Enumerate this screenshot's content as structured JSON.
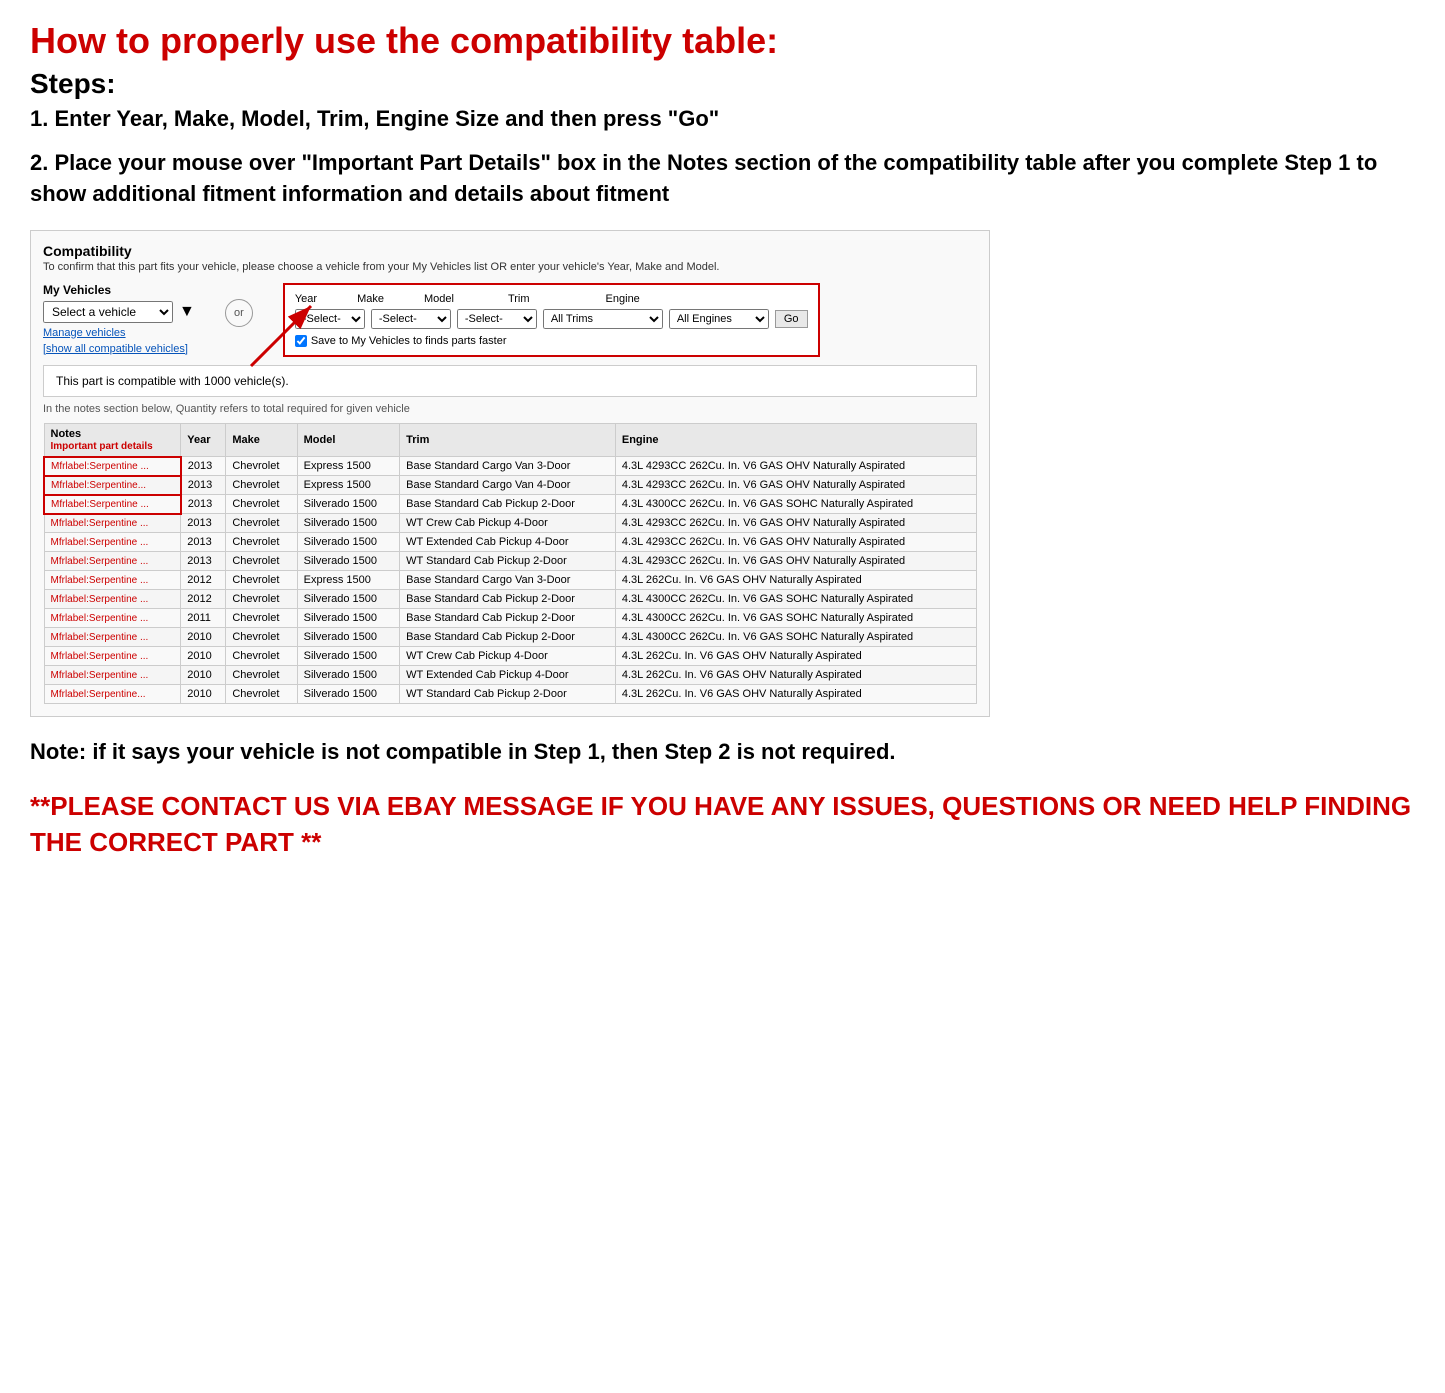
{
  "title": "How to properly use the compatibility table:",
  "steps_heading": "Steps:",
  "step1": "1. Enter Year, Make, Model, Trim, Engine Size and then press \"Go\"",
  "step2": "2. Place your mouse over \"Important Part Details\" box in the Notes section of the compatibility table after you complete Step 1 to show additional fitment information and details about fitment",
  "compatibility": {
    "title": "Compatibility",
    "subtitle": "To confirm that this part fits your vehicle, please choose a vehicle from your My Vehicles list OR enter your vehicle's Year, Make and Model.",
    "my_vehicles_label": "My Vehicles",
    "select_vehicle_placeholder": "Select a vehicle",
    "manage_vehicles": "Manage vehicles",
    "show_all": "[show all compatible vehicles]",
    "or_label": "or",
    "year_label": "Year",
    "make_label": "Make",
    "model_label": "Model",
    "trim_label": "Trim",
    "engine_label": "Engine",
    "year_default": "-Select-",
    "make_default": "-Select-",
    "model_default": "-Select-",
    "trim_default": "All Trims",
    "engine_default": "All Engines",
    "go_button": "Go",
    "save_check_label": "Save to My Vehicles to finds parts faster",
    "compatible_text": "This part is compatible with 1000 vehicle(s).",
    "quantity_note": "In the notes section below, Quantity refers to total required for given vehicle",
    "table_headers": [
      "Notes",
      "Year",
      "Make",
      "Model",
      "Trim",
      "Engine"
    ],
    "notes_sub_header": "Important part details",
    "table_rows": [
      [
        "Mfrlabel:Serpentine ...",
        "2013",
        "Chevrolet",
        "Express 1500",
        "Base Standard Cargo Van 3-Door",
        "4.3L 4293CC 262Cu. In. V6 GAS OHV Naturally Aspirated"
      ],
      [
        "Mfrlabel:Serpentine...",
        "2013",
        "Chevrolet",
        "Express 1500",
        "Base Standard Cargo Van 4-Door",
        "4.3L 4293CC 262Cu. In. V6 GAS OHV Naturally Aspirated"
      ],
      [
        "Mfrlabel:Serpentine ...",
        "2013",
        "Chevrolet",
        "Silverado 1500",
        "Base Standard Cab Pickup 2-Door",
        "4.3L 4300CC 262Cu. In. V6 GAS SOHC Naturally Aspirated"
      ],
      [
        "Mfrlabel:Serpentine ...",
        "2013",
        "Chevrolet",
        "Silverado 1500",
        "WT Crew Cab Pickup 4-Door",
        "4.3L 4293CC 262Cu. In. V6 GAS OHV Naturally Aspirated"
      ],
      [
        "Mfrlabel:Serpentine ...",
        "2013",
        "Chevrolet",
        "Silverado 1500",
        "WT Extended Cab Pickup 4-Door",
        "4.3L 4293CC 262Cu. In. V6 GAS OHV Naturally Aspirated"
      ],
      [
        "Mfrlabel:Serpentine ...",
        "2013",
        "Chevrolet",
        "Silverado 1500",
        "WT Standard Cab Pickup 2-Door",
        "4.3L 4293CC 262Cu. In. V6 GAS OHV Naturally Aspirated"
      ],
      [
        "Mfrlabel:Serpentine ...",
        "2012",
        "Chevrolet",
        "Express 1500",
        "Base Standard Cargo Van 3-Door",
        "4.3L 262Cu. In. V6 GAS OHV Naturally Aspirated"
      ],
      [
        "Mfrlabel:Serpentine ...",
        "2012",
        "Chevrolet",
        "Silverado 1500",
        "Base Standard Cab Pickup 2-Door",
        "4.3L 4300CC 262Cu. In. V6 GAS SOHC Naturally Aspirated"
      ],
      [
        "Mfrlabel:Serpentine ...",
        "2011",
        "Chevrolet",
        "Silverado 1500",
        "Base Standard Cab Pickup 2-Door",
        "4.3L 4300CC 262Cu. In. V6 GAS SOHC Naturally Aspirated"
      ],
      [
        "Mfrlabel:Serpentine ...",
        "2010",
        "Chevrolet",
        "Silverado 1500",
        "Base Standard Cab Pickup 2-Door",
        "4.3L 4300CC 262Cu. In. V6 GAS SOHC Naturally Aspirated"
      ],
      [
        "Mfrlabel:Serpentine ...",
        "2010",
        "Chevrolet",
        "Silverado 1500",
        "WT Crew Cab Pickup 4-Door",
        "4.3L 262Cu. In. V6 GAS OHV Naturally Aspirated"
      ],
      [
        "Mfrlabel:Serpentine ...",
        "2010",
        "Chevrolet",
        "Silverado 1500",
        "WT Extended Cab Pickup 4-Door",
        "4.3L 262Cu. In. V6 GAS OHV Naturally Aspirated"
      ],
      [
        "Mfrlabel:Serpentine...",
        "2010",
        "Chevrolet",
        "Silverado 1500",
        "WT Standard Cab Pickup 2-Door",
        "4.3L 262Cu. In. V6 GAS OHV Naturally Aspirated"
      ]
    ]
  },
  "note": "Note: if it says your vehicle is not compatible in Step 1, then Step 2 is not required.",
  "contact": "**PLEASE CONTACT US VIA EBAY MESSAGE IF YOU HAVE ANY ISSUES, QUESTIONS OR NEED HELP FINDING THE CORRECT PART **"
}
